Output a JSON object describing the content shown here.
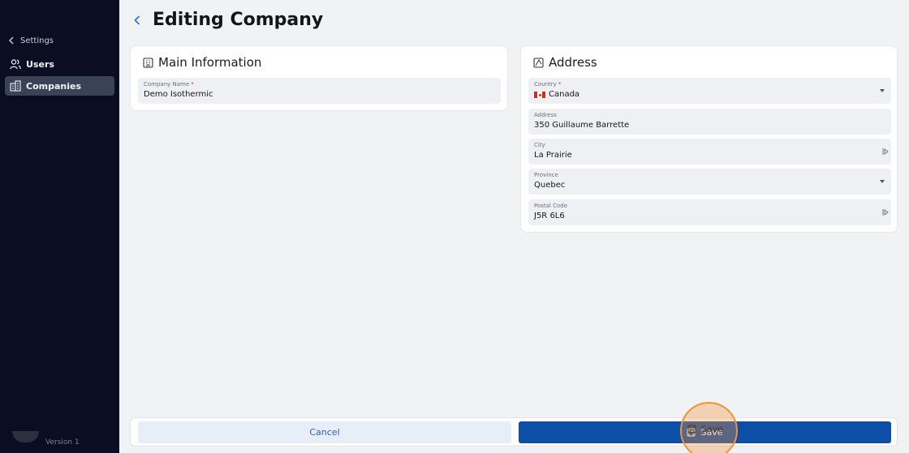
{
  "sidebar": {
    "back_label": "Settings",
    "items": [
      {
        "label": "Users",
        "icon": "users-icon"
      },
      {
        "label": "Companies",
        "icon": "buildings-icon",
        "active": true
      }
    ],
    "version": "Version 1"
  },
  "header": {
    "title": "Editing Company"
  },
  "main_info": {
    "title": "Main Information",
    "icon": "building-icon",
    "company_name": {
      "label": "Company Name",
      "required": "*",
      "value": "Demo Isothermic"
    }
  },
  "address": {
    "title": "Address",
    "icon": "map-icon",
    "country": {
      "label": "Country",
      "required": "*",
      "value": "Canada"
    },
    "address": {
      "label": "Address",
      "value": "350 Guillaume Barrette"
    },
    "city": {
      "label": "City",
      "value": "La Prairie"
    },
    "province": {
      "label": "Province",
      "value": "Quebec"
    },
    "postal_code": {
      "label": "Postal Code",
      "value": "J5R 6L6"
    }
  },
  "actions": {
    "cancel_label": "Cancel",
    "save_label": "Save"
  },
  "colors": {
    "sidebar_bg": "#0b0e23",
    "primary": "#0d4fa6",
    "highlight": "#f0923a"
  }
}
